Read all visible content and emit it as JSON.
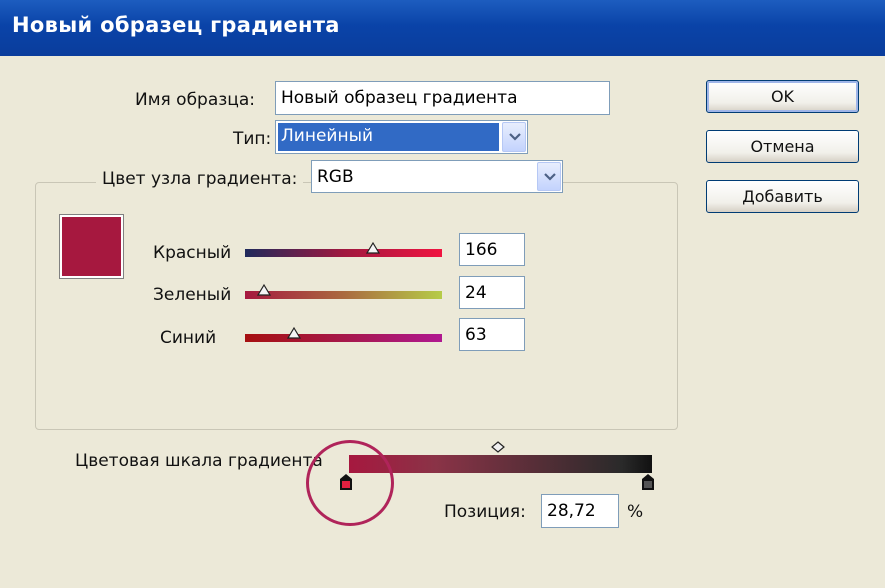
{
  "window": {
    "title": "Новый образец градиента"
  },
  "name_field": {
    "label": "Имя образца:",
    "value": "Новый образец градиента"
  },
  "type_field": {
    "label": "Тип:",
    "value": "Линейный"
  },
  "stop_color": {
    "label": "Цвет узла градиента:",
    "value": "RGB"
  },
  "swatch": {
    "color": "#a6183f"
  },
  "channels": [
    {
      "label": "Красный",
      "value": "166",
      "slider_fraction": 0.651
    },
    {
      "label": "Зеленый",
      "value": "24",
      "slider_fraction": 0.094
    },
    {
      "label": "Синий",
      "value": "63",
      "slider_fraction": 0.247
    }
  ],
  "gradient_ramp": {
    "label": "Цветовая шкала градиента",
    "selected_stop_position": 0.2872,
    "start_color": "#a6183f",
    "end_color": "#111111"
  },
  "position": {
    "label": "Позиция:",
    "value": "28,72",
    "unit": "%"
  },
  "buttons": {
    "ok": "OK",
    "cancel": "Отмена",
    "add": "Добавить"
  }
}
